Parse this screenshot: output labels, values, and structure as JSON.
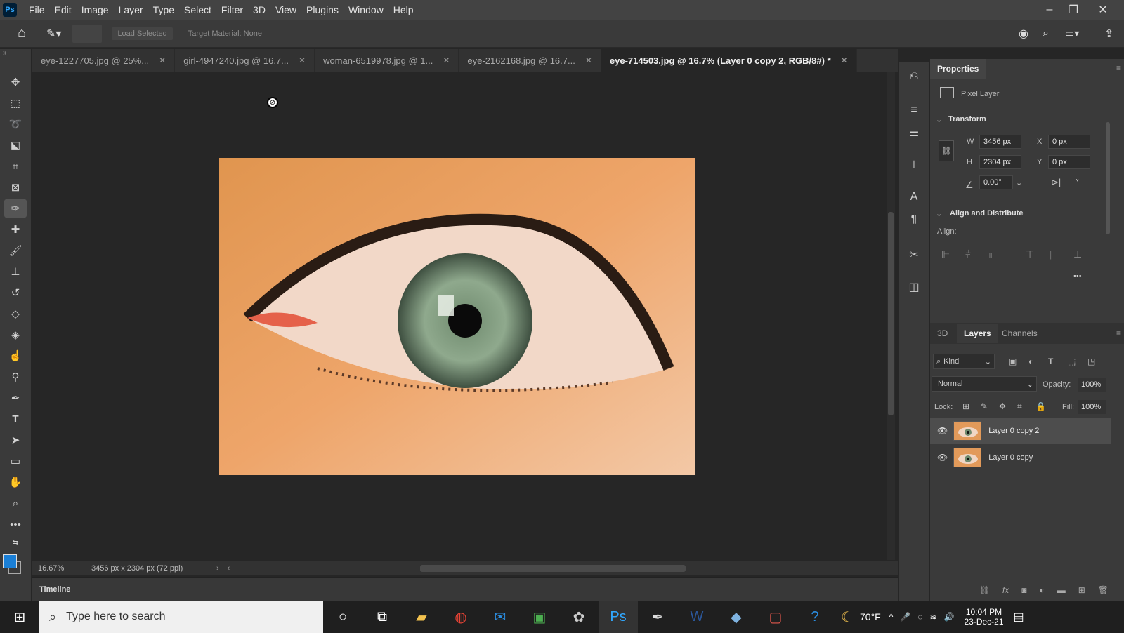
{
  "menubar": {
    "logo": "Ps",
    "items": [
      "File",
      "Edit",
      "Image",
      "Layer",
      "Type",
      "Select",
      "Filter",
      "3D",
      "View",
      "Plugins",
      "Window",
      "Help"
    ]
  },
  "options": {
    "load_selected": "Load Selected",
    "target_material": "Target Material: None"
  },
  "tabs": [
    {
      "label": "eye-1227705.jpg @ 25%..."
    },
    {
      "label": "girl-4947240.jpg @ 16.7..."
    },
    {
      "label": "woman-6519978.jpg @ 1..."
    },
    {
      "label": "eye-2162168.jpg @ 16.7..."
    },
    {
      "label": "eye-714503.jpg @ 16.7% (Layer 0 copy 2, RGB/8#) *"
    }
  ],
  "status": {
    "zoom": "16.67%",
    "doc_size": "3456 px x 2304 px (72 ppi)"
  },
  "timeline_label": "Timeline",
  "properties": {
    "tab": "Properties",
    "layer_type": "Pixel Layer",
    "transform_title": "Transform",
    "w_label": "W",
    "w_value": "3456 px",
    "h_label": "H",
    "h_value": "2304 px",
    "x_label": "X",
    "x_value": "0 px",
    "y_label": "Y",
    "y_value": "0 px",
    "angle_value": "0.00°",
    "align_title": "Align and Distribute",
    "align_label": "Align:",
    "more": "•••"
  },
  "layers_panel": {
    "tabs": [
      "3D",
      "Layers",
      "Channels"
    ],
    "filter_kind": "Kind",
    "blend_mode": "Normal",
    "opacity_label": "Opacity:",
    "opacity_value": "100%",
    "lock_label": "Lock:",
    "fill_label": "Fill:",
    "fill_value": "100%",
    "layers": [
      {
        "name": "Layer 0 copy 2",
        "selected": true
      },
      {
        "name": "Layer 0 copy",
        "selected": false
      }
    ]
  },
  "taskbar": {
    "search_placeholder": "Type here to search",
    "weather": "70°F",
    "time": "10:04 PM",
    "date": "23-Dec-21"
  },
  "colors": {
    "accent": "#31a8ff",
    "foreground_swatch": "#1a7fd6",
    "panel_bg": "#3a3a3a"
  }
}
